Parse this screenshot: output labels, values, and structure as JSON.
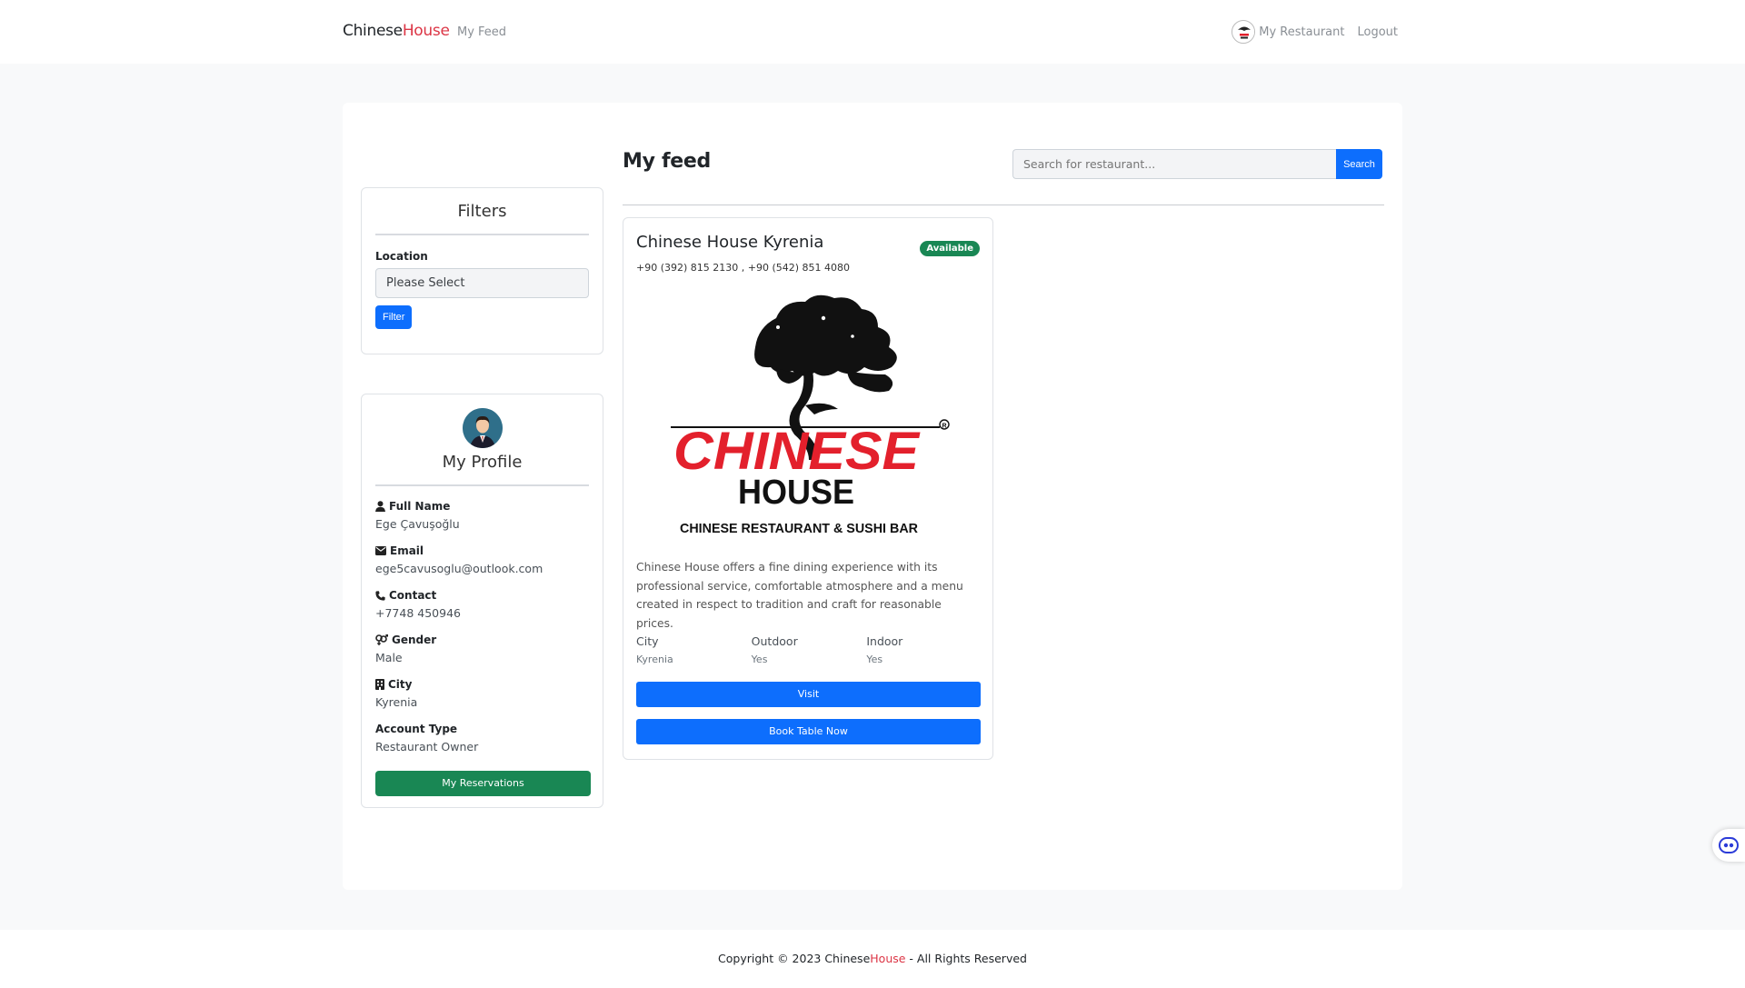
{
  "nav": {
    "brand_main": "Chinese",
    "brand_accent": "House",
    "feed_link": "My Feed",
    "restaurant_link": "My Restaurant",
    "logout_link": "Logout"
  },
  "filters": {
    "title": "Filters",
    "location_label": "Location",
    "location_value": "Please Select",
    "filter_button": "Filter"
  },
  "profile": {
    "title": "My Profile",
    "full_name_label": "Full Name",
    "full_name": "Ege Çavuşoğlu",
    "email_label": "Email",
    "email": "ege5cavusoglu@outlook.com",
    "contact_label": "Contact",
    "contact": "+7748 450946",
    "gender_label": "Gender",
    "gender": "Male",
    "city_label": "City",
    "city": "Kyrenia",
    "account_type_label": "Account Type",
    "account_type": "Restaurant Owner",
    "reservations_button": "My Reservations"
  },
  "feed": {
    "title": "My feed",
    "search_placeholder": "Search for restaurant...",
    "search_button": "Search"
  },
  "restaurant": {
    "name": "Chinese House Kyrenia",
    "status": "Available",
    "phones": "+90 (392) 815 2130 , +90 (542) 851 4080",
    "logo_word1": "CHINESE",
    "logo_word2": "HOUSE",
    "logo_tagline": "CHINESE RESTAURANT & SUSHI BAR",
    "description": "Chinese House offers a fine dining experience with its professional service, comfortable atmosphere and a menu created in respect to tradition and craft for reasonable prices.",
    "attributes": [
      {
        "key": "City",
        "value": "Kyrenia"
      },
      {
        "key": "Outdoor",
        "value": "Yes"
      },
      {
        "key": "Indoor",
        "value": "Yes"
      }
    ],
    "visit_button": "Visit",
    "book_button": "Book Table Now"
  },
  "footer": {
    "copyright_prefix": "Copyright © 2023 Chinese",
    "brand_accent": "House",
    "copyright_suffix": " - All Rights Reserved"
  },
  "colors": {
    "primary": "#0d6efd",
    "success": "#198754",
    "brand_red": "#dc3545",
    "logo_red": "#e3202c"
  }
}
